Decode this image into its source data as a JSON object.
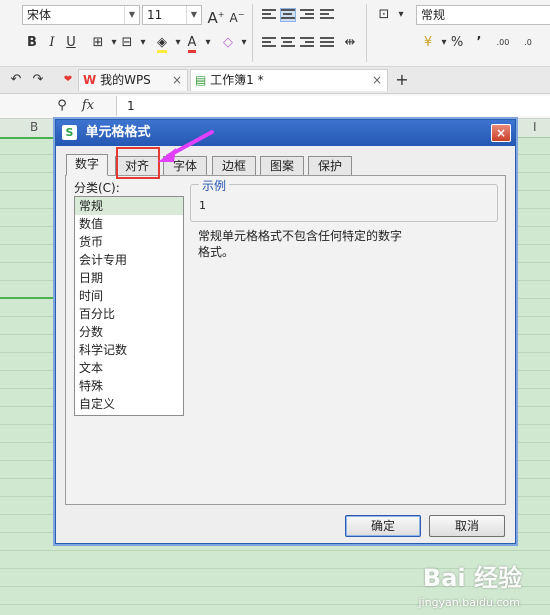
{
  "ribbon": {
    "font_name": "宋体",
    "font_size": "11",
    "grow_font": "A",
    "shrink_font": "A",
    "bold": "B",
    "italic": "I",
    "underline": "U",
    "font_color": "A",
    "number_format": "常规",
    "percent": "%",
    "comma": "’",
    "inc_decimal": ".00",
    "dec_decimal": ".0"
  },
  "tabs": {
    "wps_label": "我的WPS",
    "doc_label": "工作簿1 *",
    "close": "×",
    "add": "+"
  },
  "formula_bar": {
    "fx": "fx",
    "value": "1"
  },
  "sheet": {
    "col_b": "B",
    "col_i": "I"
  },
  "dialog": {
    "title": "单元格格式",
    "app_icon": "S",
    "close": "×",
    "tabs": [
      "数字",
      "对齐",
      "字体",
      "边框",
      "图案",
      "保护"
    ],
    "category_label": "分类(C):",
    "categories": [
      "常规",
      "数值",
      "货币",
      "会计专用",
      "日期",
      "时间",
      "百分比",
      "分数",
      "科学记数",
      "文本",
      "特殊",
      "自定义"
    ],
    "sample_label": "示例",
    "sample_value": "1",
    "description_line1": "常规单元格格式不包含任何特定的数字",
    "description_line2": "格式。",
    "ok": "确定",
    "cancel": "取消"
  },
  "watermark": {
    "brand": "Bai 经验",
    "url": "jingyan.baidu.com"
  },
  "colors": {
    "dialog_title": "#2457b3",
    "sheet_bg": "#cfe8cf",
    "highlight_box": "#e53935",
    "arrow": "#e040fb"
  }
}
